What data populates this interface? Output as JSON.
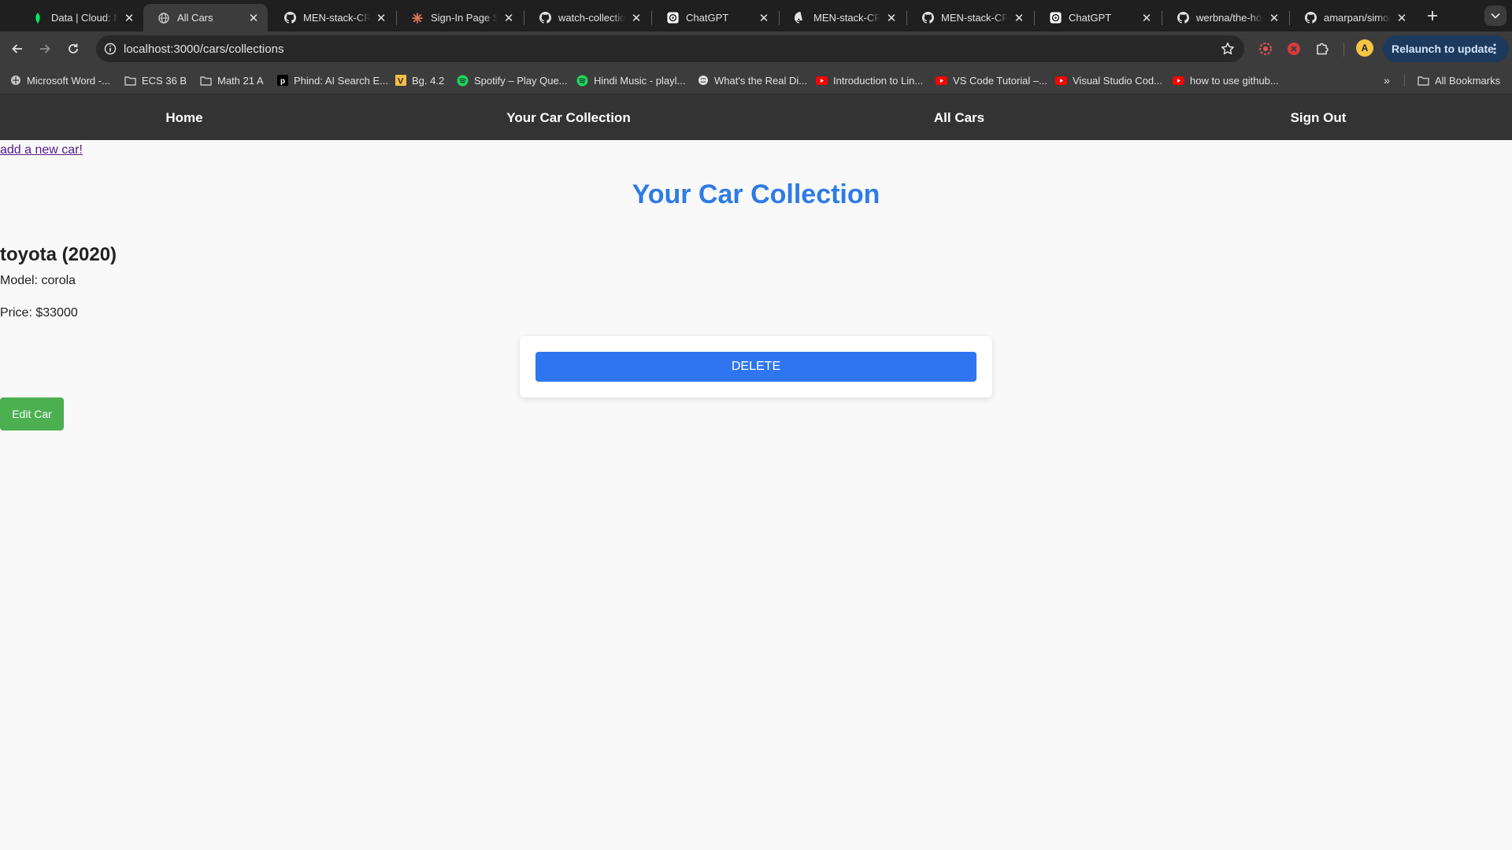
{
  "browser": {
    "tabs": [
      {
        "title": "Data | Cloud: Mo",
        "icon": "mongodb-leaf-icon"
      },
      {
        "title": "All Cars",
        "icon": "globe-icon",
        "active": true
      },
      {
        "title": "MEN-stack-CRU",
        "icon": "github-icon"
      },
      {
        "title": "Sign-In Page St",
        "icon": "claude-icon"
      },
      {
        "title": "watch-collection",
        "icon": "github-icon"
      },
      {
        "title": "ChatGPT",
        "icon": "chatgpt-icon"
      },
      {
        "title": "MEN-stack-CRU",
        "icon": "github-icon"
      },
      {
        "title": "MEN-stack-CRU",
        "icon": "github-icon"
      },
      {
        "title": "ChatGPT",
        "icon": "chatgpt-icon"
      },
      {
        "title": "werbna/the-hom",
        "icon": "github-icon"
      },
      {
        "title": "amarpan/simon",
        "icon": "github-icon"
      }
    ],
    "url": "localhost:3000/cars/collections",
    "relaunch_label": "Relaunch to update",
    "avatar_letter": "A",
    "bookmarks": [
      {
        "label": "Microsoft Word -...",
        "icon": "globe-icon"
      },
      {
        "label": "ECS 36 B",
        "icon": "folder-icon"
      },
      {
        "label": "Math 21 A",
        "icon": "folder-icon"
      },
      {
        "label": "Phind: AI Search E...",
        "icon": "phind-icon"
      },
      {
        "label": "Bg. 4.2",
        "icon": "vedabase-icon"
      },
      {
        "label": "Spotify – Play Que...",
        "icon": "spotify-icon"
      },
      {
        "label": "Hindi Music - playl...",
        "icon": "spotify-icon"
      },
      {
        "label": "What's the Real Di...",
        "icon": "globe-icon"
      },
      {
        "label": "Introduction to Lin...",
        "icon": "youtube-icon"
      },
      {
        "label": "VS Code Tutorial –...",
        "icon": "youtube-icon"
      },
      {
        "label": "Visual Studio Cod...",
        "icon": "youtube-icon"
      },
      {
        "label": "how to use github...",
        "icon": "youtube-icon"
      }
    ],
    "all_bookmarks_label": "All Bookmarks"
  },
  "site": {
    "nav": {
      "home": "Home",
      "collection": "Your Car Collection",
      "all_cars": "All Cars",
      "sign_out": "Sign Out"
    },
    "add_link": "add a new car!",
    "page_title": "Your Car Collection",
    "car": {
      "heading": "toyota (2020)",
      "model": "Model: corola",
      "price": "Price: $33000"
    },
    "delete_label": "DELETE",
    "edit_label": "Edit Car"
  },
  "colors": {
    "title_blue": "#2e7be6",
    "delete_blue": "#2f75f0",
    "edit_green": "#4caf50",
    "site_nav_bg": "#333333",
    "chrome_dark": "#1f1f1f"
  }
}
